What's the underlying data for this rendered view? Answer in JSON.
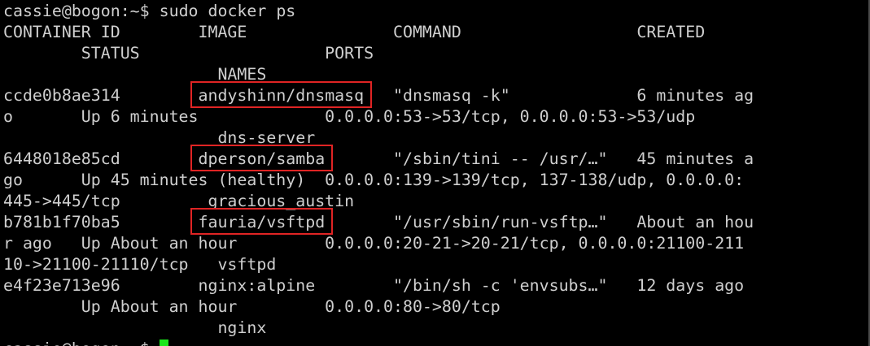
{
  "colors": {
    "background": "#000000",
    "foreground": "#cfcfcf",
    "highlight_box": "#e02424",
    "cursor": "#19e619"
  },
  "terminal": {
    "prompt1": {
      "prompt": "cassie@bogon:~$",
      "command": "sudo docker ps"
    },
    "output": [
      "CONTAINER ID        IMAGE               COMMAND                  CREATED",
      "        STATUS                   PORTS",
      "                      NAMES",
      "ccde0b8ae314        andyshinn/dnsmasq   \"dnsmasq -k\"             6 minutes ag",
      "o       Up 6 minutes             0.0.0.0:53->53/tcp, 0.0.0.0:53->53/udp",
      "                      dns-server",
      "6448018e85cd        dperson/samba       \"/sbin/tini -- /usr/…\"   45 minutes a",
      "go      Up 45 minutes (healthy)  0.0.0.0:139->139/tcp, 137-138/udp, 0.0.0.0:",
      "445->445/tcp         gracious_austin",
      "b781b1f70ba5        fauria/vsftpd       \"/usr/sbin/run-vsftp…\"   About an hou",
      "r ago   Up About an hour         0.0.0.0:20-21->20-21/tcp, 0.0.0.0:21100-211",
      "10->21100-21110/tcp   vsftpd",
      "e4f23e713e96        nginx:alpine        \"/bin/sh -c 'envsubs…\"   12 days ago",
      "        Up About an hour         0.0.0.0:80->80/tcp",
      "                      nginx"
    ],
    "highlighted_images": [
      "andyshinn/dnsmasq",
      "dperson/samba",
      "fauria/vsftpd"
    ],
    "prompt2": {
      "prompt": "cassie@bogon:~$",
      "command": ""
    }
  }
}
